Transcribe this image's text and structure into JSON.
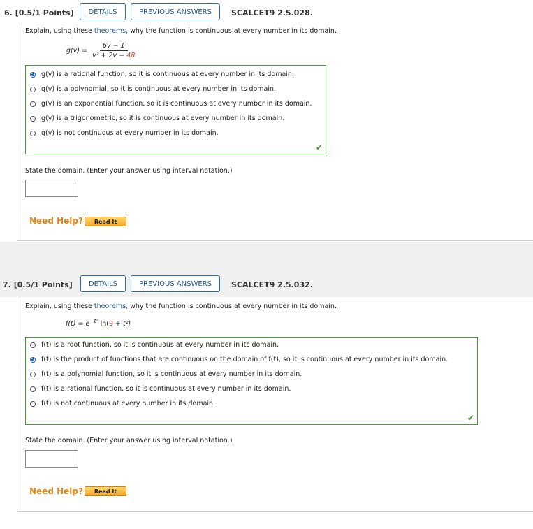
{
  "q6": {
    "number": "6.",
    "points": "[0.5/1 Points]",
    "details_label": "DETAILS",
    "previous_answers_label": "PREVIOUS ANSWERS",
    "assignment_id": "SCALCET9 2.5.028.",
    "instr_pre": "Explain, using these ",
    "instr_link": "theorems,",
    "instr_post": " why the function is continuous at every number in its domain.",
    "formula_lhs": "g(v) =",
    "formula_num": "6v − 1",
    "formula_den_a": "v² + 2v − ",
    "formula_den_b": "48",
    "choices": [
      "g(v) is a rational function, so it is continuous at every number in its domain.",
      "g(v) is a polynomial, so it is continuous at every number in its domain.",
      "g(v) is an exponential function, so it is continuous at every number in its domain.",
      "g(v) is a trigonometric, so it is continuous at every number in its domain.",
      "g(v) is not continuous at every number in its domain."
    ],
    "selected_index": 0,
    "domain_prompt": "State the domain. (Enter your answer using interval notation.)",
    "domain_value": "",
    "need_help": "Need Help?",
    "read_it": "Read It"
  },
  "q7": {
    "number": "7.",
    "points": "[0.5/1 Points]",
    "details_label": "DETAILS",
    "previous_answers_label": "PREVIOUS ANSWERS",
    "assignment_id": "SCALCET9 2.5.032.",
    "instr_pre": "Explain, using these ",
    "instr_link": "theorems,",
    "instr_post": " why the function is continuous at every number in its domain.",
    "formula_lhs": "f(t) = e",
    "formula_exp": "−t²",
    "formula_ln": " ln(",
    "formula_arg_a": "9",
    "formula_arg_b": " + t²)",
    "choices": [
      "f(t) is a root function, so it is continuous at every number in its domain.",
      "f(t) is the product of functions that are continuous on the domain of f(t), so it is continuous at every number in its domain.",
      "f(t) is a polynomial function, so it is continuous at every number in its domain.",
      "f(t) is a rational function, so it is continuous at every number in its domain.",
      "f(t) is not continuous at every number in its domain."
    ],
    "selected_index": 1,
    "domain_prompt": "State the domain. (Enter your answer using interval notation.)",
    "domain_value": "",
    "need_help": "Need Help?",
    "read_it": "Read It"
  },
  "icons": {
    "correct": "checkmark-icon"
  },
  "colors": {
    "correct_green": "#4a9a3a",
    "link_blue": "#1f5a96",
    "help_orange": "#e08a1a"
  }
}
